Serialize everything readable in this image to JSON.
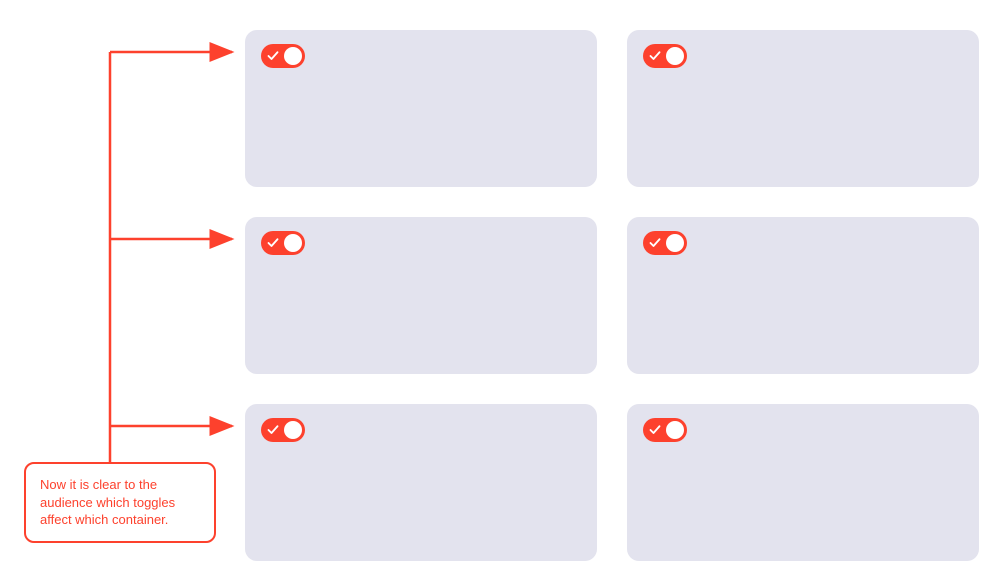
{
  "annotation": {
    "text": "Now it is clear to the audience which toggles affect which container."
  },
  "colors": {
    "accent": "#fd412d",
    "card_bg": "#e3e3ee"
  },
  "toggles": [
    {
      "row": 0,
      "col": 0,
      "on": true
    },
    {
      "row": 0,
      "col": 1,
      "on": true
    },
    {
      "row": 1,
      "col": 0,
      "on": true
    },
    {
      "row": 1,
      "col": 1,
      "on": true
    },
    {
      "row": 2,
      "col": 0,
      "on": true
    },
    {
      "row": 2,
      "col": 1,
      "on": true
    }
  ]
}
